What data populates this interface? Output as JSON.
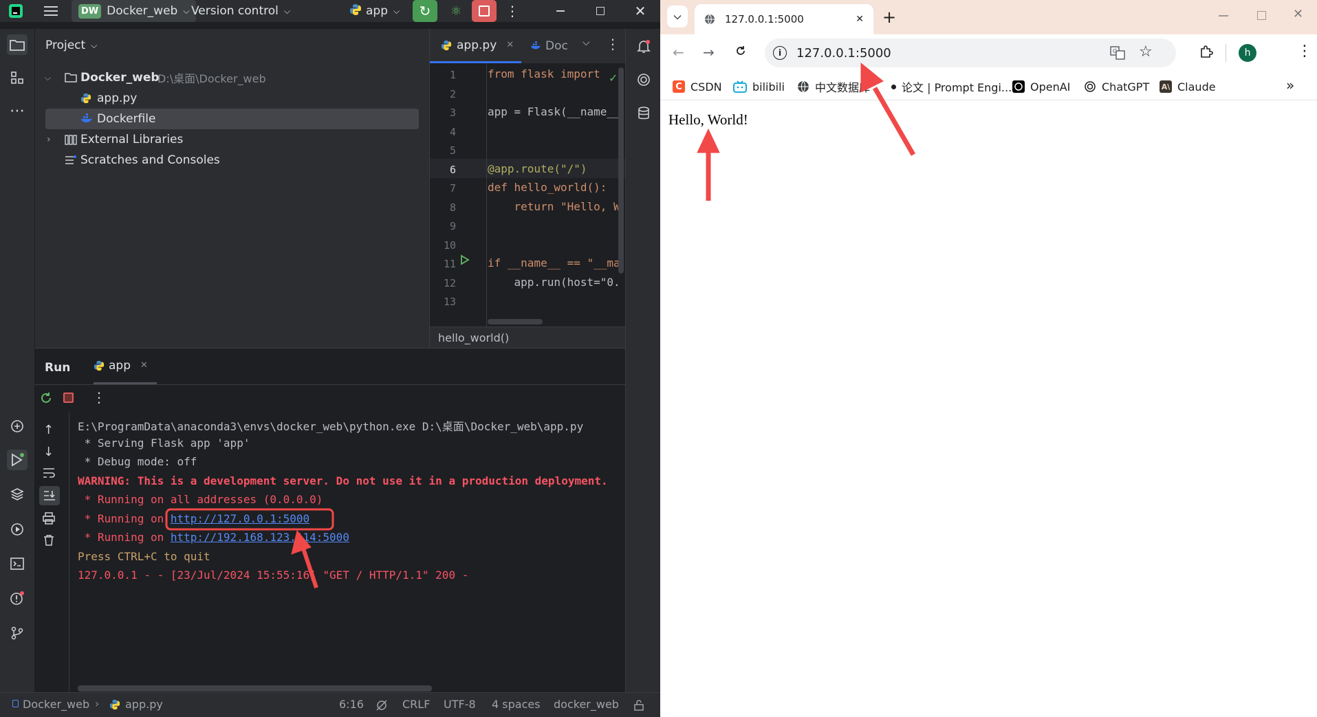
{
  "ide": {
    "app_badge": "DW",
    "project_name": "Docker_web",
    "version_control": "Version control",
    "run_config": "app",
    "project_panel_title": "Project",
    "tree": [
      {
        "label": "Docker_web",
        "path": "D:\\桌面\\Docker_web"
      },
      {
        "label": "app.py"
      },
      {
        "label": "Dockerfile"
      },
      {
        "label": "External Libraries"
      },
      {
        "label": "Scratches and Consoles"
      }
    ],
    "editor_tabs": [
      {
        "label": "app.py"
      },
      {
        "label": "Doc"
      }
    ],
    "line_numbers": [
      "1",
      "2",
      "3",
      "4",
      "5",
      "6",
      "7",
      "8",
      "9",
      "10",
      "11",
      "12",
      "13"
    ],
    "code_lines": [
      "from flask import",
      "",
      "app = Flask(__name__",
      "",
      "",
      "@app.route(\"/\")",
      "def hello_world():",
      "    return \"Hello, W",
      "",
      "",
      "if __name__ == \"__ma",
      "    app.run(host=\"0.",
      ""
    ],
    "breadcrumb": "hello_world()",
    "run_title": "Run",
    "run_tab": "app",
    "console": [
      {
        "text": "E:\\ProgramData\\anaconda3\\envs\\docker_web\\python.exe D:\\桌面\\Docker_web\\app.py"
      },
      {
        "text": " * Serving Flask app 'app'"
      },
      {
        "text": " * Debug mode: off"
      },
      {
        "text": "WARNING: This is a development server. Do not use it in a production deployment."
      },
      {
        "text": " * Running on all addresses (0.0.0.0)"
      },
      {
        "prefix": " * Running on ",
        "link": "http://127.0.0.1:5000"
      },
      {
        "prefix": " * Running on ",
        "link": "http://192.168.123.114:5000"
      },
      {
        "text": "Press CTRL+C to quit"
      },
      {
        "text": "127.0.0.1 - - [23/Jul/2024 15:55:16] \"GET / HTTP/1.1\" 200 -"
      }
    ],
    "status": {
      "crumb_project": "Docker_web",
      "crumb_file": "app.py",
      "position": "6:16",
      "line_sep": "CRLF",
      "encoding": "UTF-8",
      "indent": "4 spaces",
      "interpreter": "docker_web"
    },
    "colors": {
      "bg": "#1e1f22",
      "panel": "#2b2d30",
      "accent": "#3574f0",
      "warning": "#f75464",
      "link": "#548af7",
      "run_green": "#499c54",
      "stop_red": "#db5c5c"
    }
  },
  "browser": {
    "tab_title": "127.0.0.1:5000",
    "url": "127.0.0.1:5000",
    "profile_initial": "h",
    "bookmarks": [
      {
        "label": "CSDN"
      },
      {
        "label": "bilibili"
      },
      {
        "label": "中文数据库"
      },
      {
        "label": "论文 | Prompt Engi..."
      },
      {
        "label": "OpenAI"
      },
      {
        "label": "ChatGPT"
      },
      {
        "label": "Claude"
      }
    ],
    "page_text": "Hello, World!"
  },
  "annotations": {
    "highlight_color": "#f14848"
  }
}
